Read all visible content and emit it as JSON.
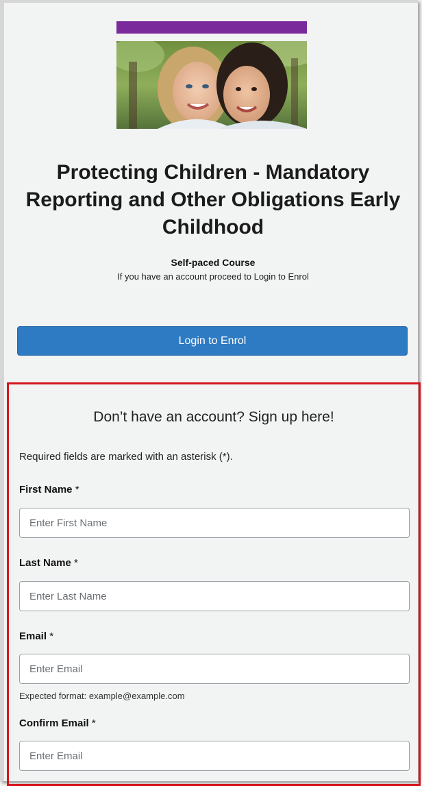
{
  "course": {
    "title": "Protecting Children - Mandatory Reporting and Other Obligations Early Childhood",
    "type": "Self-paced Course",
    "hint": "If you have an account proceed to Login to Enrol",
    "login_label": "Login to Enrol",
    "banner_color": "#7a2a9b",
    "banner_image": "two-smiling-children-photo"
  },
  "signup": {
    "title": "Don’t have an account? Sign up here!",
    "required_note": "Required fields are marked with an asterisk (*).",
    "highlight_color": "#d6141c",
    "fields": [
      {
        "label": "First Name",
        "required_mark": "*",
        "placeholder": "Enter First Name",
        "value": ""
      },
      {
        "label": "Last Name",
        "required_mark": "*",
        "placeholder": "Enter Last Name",
        "value": ""
      },
      {
        "label": "Email",
        "required_mark": "*",
        "placeholder": "Enter Email",
        "value": "",
        "help": "Expected format: example@example.com"
      },
      {
        "label": "Confirm Email",
        "required_mark": "*",
        "placeholder": "Enter Email",
        "value": ""
      }
    ]
  },
  "colors": {
    "primary_button": "#2e7bc3",
    "page_background": "#f2f3f3"
  }
}
